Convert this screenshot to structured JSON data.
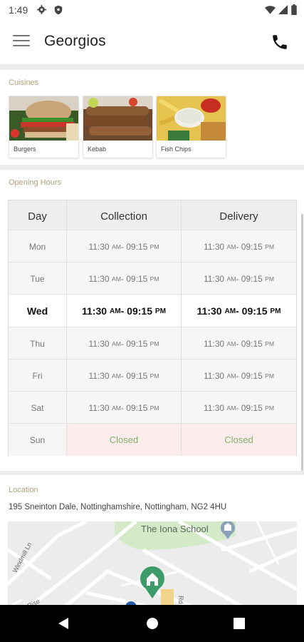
{
  "status_bar": {
    "time": "1:49"
  },
  "app_bar": {
    "title": "Georgios"
  },
  "cuisines": {
    "label": "Cuisines",
    "items": [
      {
        "label": "Burgers"
      },
      {
        "label": "Kebab"
      },
      {
        "label": "Fish  Chips"
      }
    ]
  },
  "opening_hours": {
    "label": "Opening Hours",
    "headers": [
      "Day",
      "Collection",
      "Delivery"
    ],
    "rows": [
      {
        "day": "Mon",
        "collection": [
          "11:30",
          "AM",
          " - 09:15",
          "PM"
        ],
        "delivery": [
          "11:30",
          "AM",
          " - 09:15",
          "PM"
        ]
      },
      {
        "day": "Tue",
        "collection": [
          "11:30",
          "AM",
          " - 09:15",
          "PM"
        ],
        "delivery": [
          "11:30",
          "AM",
          " - 09:15",
          "PM"
        ]
      },
      {
        "day": "Wed",
        "collection": [
          "11:30",
          "AM",
          " - 09:15",
          "PM"
        ],
        "delivery": [
          "11:30",
          "AM",
          " - 09:15",
          "PM"
        ]
      },
      {
        "day": "Thu",
        "collection": [
          "11:30",
          "AM",
          " - 09:15",
          "PM"
        ],
        "delivery": [
          "11:30",
          "AM",
          " - 09:15",
          "PM"
        ]
      },
      {
        "day": "Fri",
        "collection": [
          "11:30",
          "AM",
          " - 09:15",
          "PM"
        ],
        "delivery": [
          "11:30",
          "AM",
          " - 09:15",
          "PM"
        ]
      },
      {
        "day": "Sat",
        "collection": [
          "11:30",
          "AM",
          " - 09:15",
          "PM"
        ],
        "delivery": [
          "11:30",
          "AM",
          " - 09:15",
          "PM"
        ]
      }
    ],
    "sunday": {
      "day": "Sun",
      "collection": "Closed",
      "delivery": "Closed"
    }
  },
  "location": {
    "label": "Location",
    "address": "195 Sneinton Dale, Nottinghamshire, Nottingham, NG2 4HU",
    "map_labels": {
      "school": "The Iona School",
      "street1": "Windmill Ln",
      "street2": "Rise",
      "street3": "Rd"
    }
  },
  "colors": {
    "accent_label": "#b3a07a",
    "closed_text": "#7cb36c",
    "closed_bg": "#fdecec",
    "map_pin": "#3d9b6a"
  }
}
